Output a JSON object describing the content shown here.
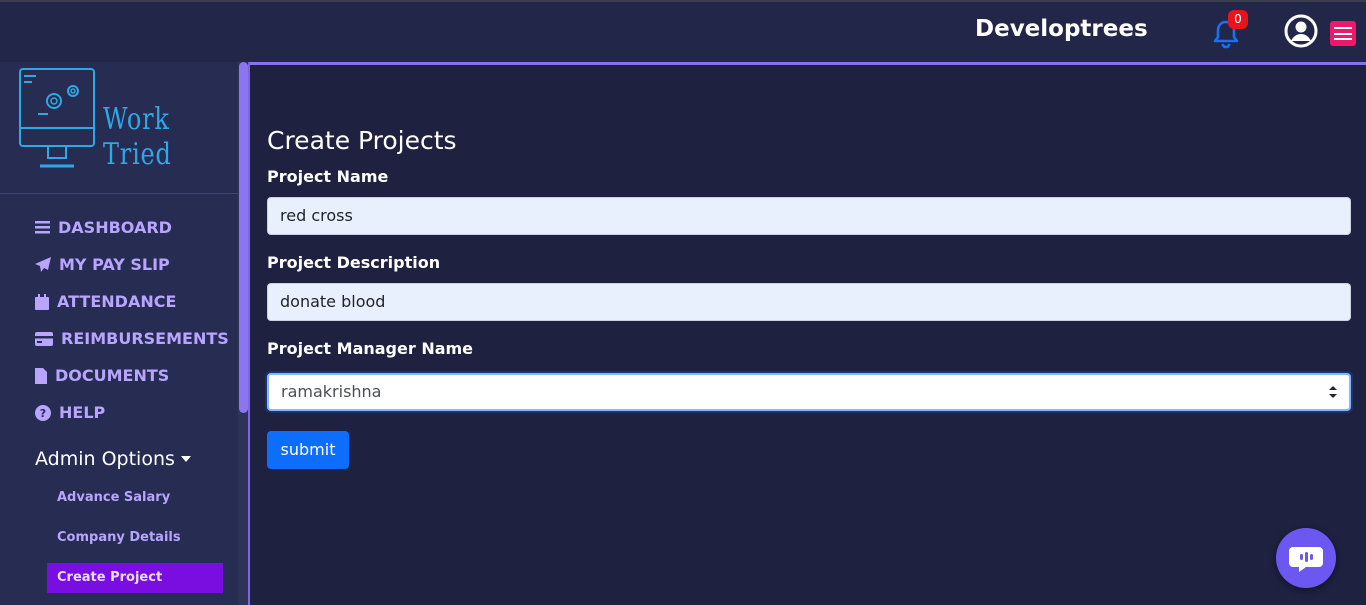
{
  "header": {
    "brand": "Developtrees",
    "notification_count": "0",
    "icons": [
      "bell-icon",
      "user-circle-icon",
      "hamburger-menu-icon"
    ],
    "accent_color": "#f0166a"
  },
  "sidebar": {
    "logo_text": "Work Tried",
    "items": [
      {
        "label": "DASHBOARD",
        "icon": "bars-icon"
      },
      {
        "label": "MY PAY SLIP",
        "icon": "paper-plane-icon"
      },
      {
        "label": "ATTENDANCE",
        "icon": "calendar-icon"
      },
      {
        "label": "REIMBURSEMENTS",
        "icon": "credit-card-icon"
      },
      {
        "label": "DOCUMENTS",
        "icon": "file-icon"
      },
      {
        "label": "HELP",
        "icon": "question-circle-icon"
      }
    ],
    "admin_title": "Admin Options",
    "admin_items": [
      {
        "label": "Advance Salary"
      },
      {
        "label": "Company Details"
      },
      {
        "label": "Create Project",
        "active": true
      }
    ]
  },
  "main": {
    "title": "Create Projects",
    "fields": {
      "project_name": {
        "label": "Project Name",
        "value": "red cross"
      },
      "project_description": {
        "label": "Project Description",
        "value": "donate blood"
      },
      "project_manager": {
        "label": "Project Manager Name",
        "value": "ramakrishna"
      }
    },
    "submit_label": "submit"
  },
  "chat": {
    "icon": "chat-bubble-icon"
  }
}
